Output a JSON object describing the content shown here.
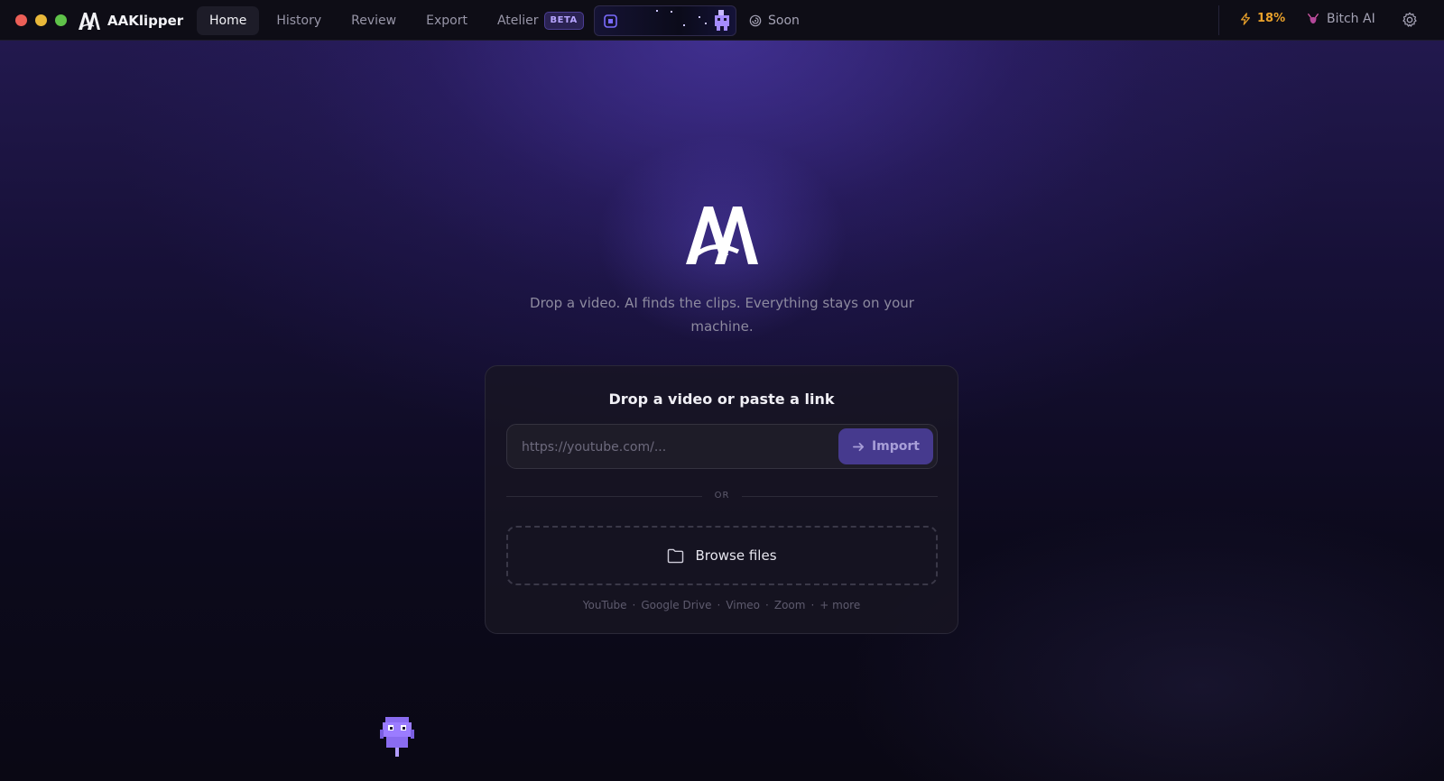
{
  "app": {
    "name": "AAKlipper"
  },
  "nav": {
    "tabs": [
      {
        "label": "Home",
        "active": true
      },
      {
        "label": "History",
        "active": false
      },
      {
        "label": "Review",
        "active": false
      },
      {
        "label": "Export",
        "active": false
      },
      {
        "label": "Atelier",
        "active": false,
        "badge": "BETA"
      }
    ]
  },
  "titlebar": {
    "soon_label": "Soon",
    "usage_percent": "18%",
    "ai_label": "Bitch AI",
    "icons": [
      "aa-logo-icon",
      "chip-icon",
      "pixel-sprite-icon",
      "spiral-icon",
      "lightning-icon",
      "devil-icon",
      "gear-icon"
    ]
  },
  "hero": {
    "tagline": "Drop a video. AI finds the clips. Everything stays on your machine."
  },
  "card": {
    "title": "Drop a video or paste a link",
    "link_placeholder": "https://youtube.com/...",
    "import_label": "Import",
    "or_label": "OR",
    "browse_label": "Browse files",
    "sources": [
      "YouTube",
      "Google Drive",
      "Vimeo",
      "Zoom",
      "+ more"
    ]
  },
  "colors": {
    "accent": "#463a8e",
    "usage": "#e9a12b",
    "background": "#0a0814"
  }
}
